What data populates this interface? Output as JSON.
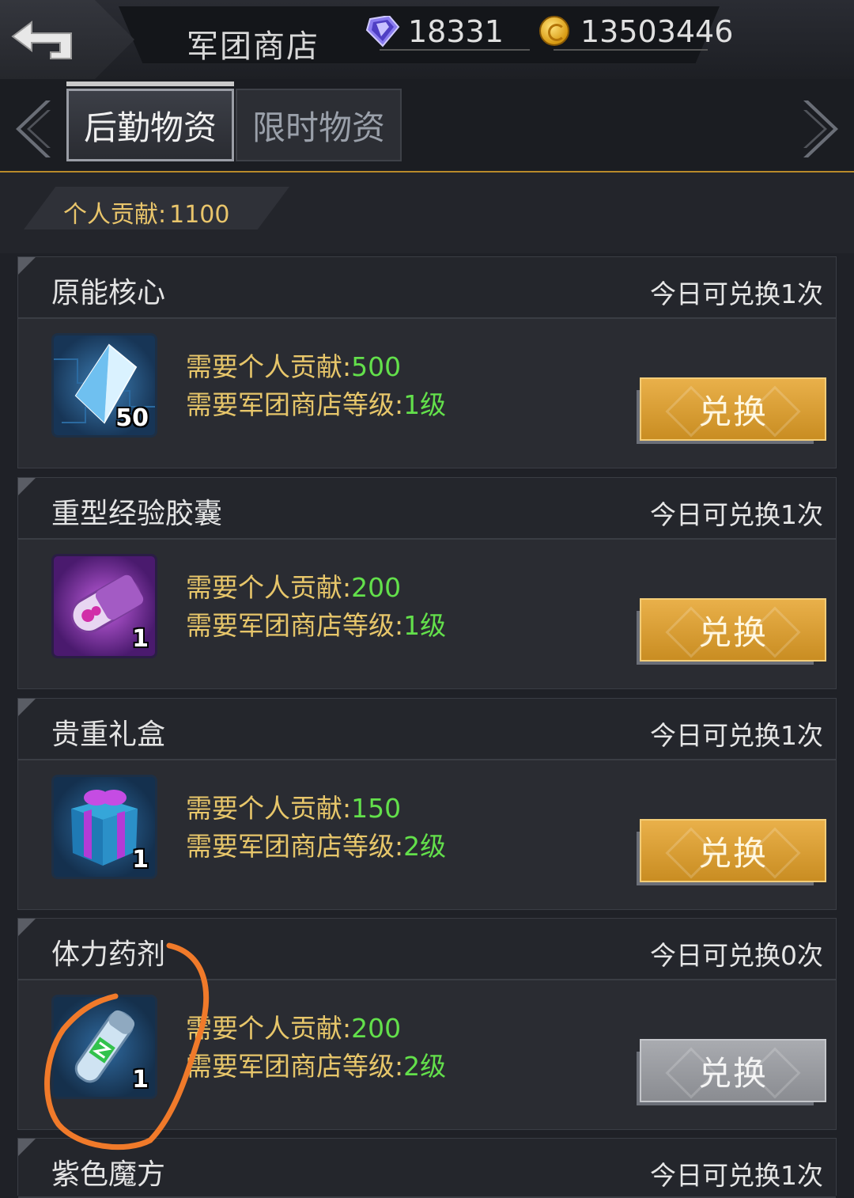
{
  "header": {
    "title": "军团商店",
    "diamonds": "18331",
    "gold": "13503446"
  },
  "tabs": [
    {
      "label": "后勤物资",
      "active": true
    },
    {
      "label": "限时物资",
      "active": false
    }
  ],
  "contribution": {
    "label": "个人贡献:",
    "value": "1100"
  },
  "items": [
    {
      "name": "原能核心",
      "limit": "今日可兑换1次",
      "qty": "50",
      "icon": "crystal-icon",
      "req_contrib_label": "需要个人贡献:",
      "req_contrib": "500",
      "req_level_label": "需要军团商店等级:",
      "req_level": "1级",
      "button": "兑换",
      "enabled": true
    },
    {
      "name": "重型经验胶囊",
      "limit": "今日可兑换1次",
      "qty": "1",
      "icon": "exp-capsule-icon",
      "req_contrib_label": "需要个人贡献:",
      "req_contrib": "200",
      "req_level_label": "需要军团商店等级:",
      "req_level": "1级",
      "button": "兑换",
      "enabled": true
    },
    {
      "name": "贵重礼盒",
      "limit": "今日可兑换1次",
      "qty": "1",
      "icon": "gift-box-icon",
      "req_contrib_label": "需要个人贡献:",
      "req_contrib": "150",
      "req_level_label": "需要军团商店等级:",
      "req_level": "2级",
      "button": "兑换",
      "enabled": true
    },
    {
      "name": "体力药剂",
      "limit": "今日可兑换0次",
      "qty": "1",
      "icon": "stamina-potion-icon",
      "req_contrib_label": "需要个人贡献:",
      "req_contrib": "200",
      "req_level_label": "需要军团商店等级:",
      "req_level": "2级",
      "button": "兑换",
      "enabled": false
    },
    {
      "name": "紫色魔方",
      "limit": "今日可兑换1次"
    }
  ],
  "colors": {
    "accent_gold": "#e7c66a",
    "value_green": "#63e04b",
    "button_gold": "#d9a035",
    "annotation_orange": "#f07a2a"
  }
}
